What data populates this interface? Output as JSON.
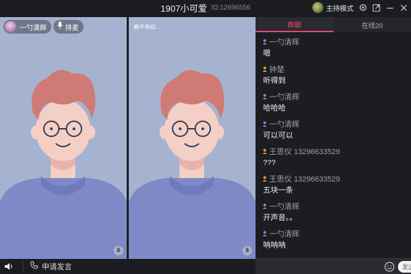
{
  "titlebar": {
    "room_title": "1907小可爱",
    "room_id": "ID:12696556",
    "host_mode": "主持模式",
    "icons": [
      "settings-icon",
      "popout-icon",
      "minimize-icon",
      "close-icon"
    ]
  },
  "video": {
    "left": {
      "name": "一勺清辉",
      "mic_button": "排麦"
    },
    "right": {
      "name": "麻不有初..."
    }
  },
  "bottom_bar": {
    "apply_speak": "申请发言"
  },
  "chat": {
    "tabs": [
      {
        "label": "群聊",
        "active": true
      },
      {
        "label": "在线20",
        "active": false
      }
    ],
    "messages": [
      {
        "name": "一勺清辉",
        "text": "嗯",
        "badge_color": "#9b7bd6"
      },
      {
        "name": "钟楚",
        "text": "听得到",
        "badge_color": "#e0a030"
      },
      {
        "name": "一勺清辉",
        "text": "哈哈哈",
        "badge_color": "#9b7bd6"
      },
      {
        "name": "一勺清辉",
        "text": "可以可以",
        "badge_color": "#9b7bd6"
      },
      {
        "name": "王思仪 13296633529",
        "text": "???",
        "badge_color": "#e0a030"
      },
      {
        "name": "王思仪 13296633529",
        "text": "五块一条",
        "badge_color": "#e0a030"
      },
      {
        "name": "一勺清辉",
        "text": "开声音。。",
        "badge_color": "#9b7bd6"
      },
      {
        "name": "一勺清辉",
        "text": "呐呐呐",
        "badge_color": "#9b7bd6"
      }
    ],
    "send_label": "发送"
  },
  "colors": {
    "accent": "#e44a6a",
    "video_bg": "#a5b3d0",
    "shirt": "#7e8ac6",
    "hair": "#cf7a74",
    "skin": "#f3cfc6"
  }
}
